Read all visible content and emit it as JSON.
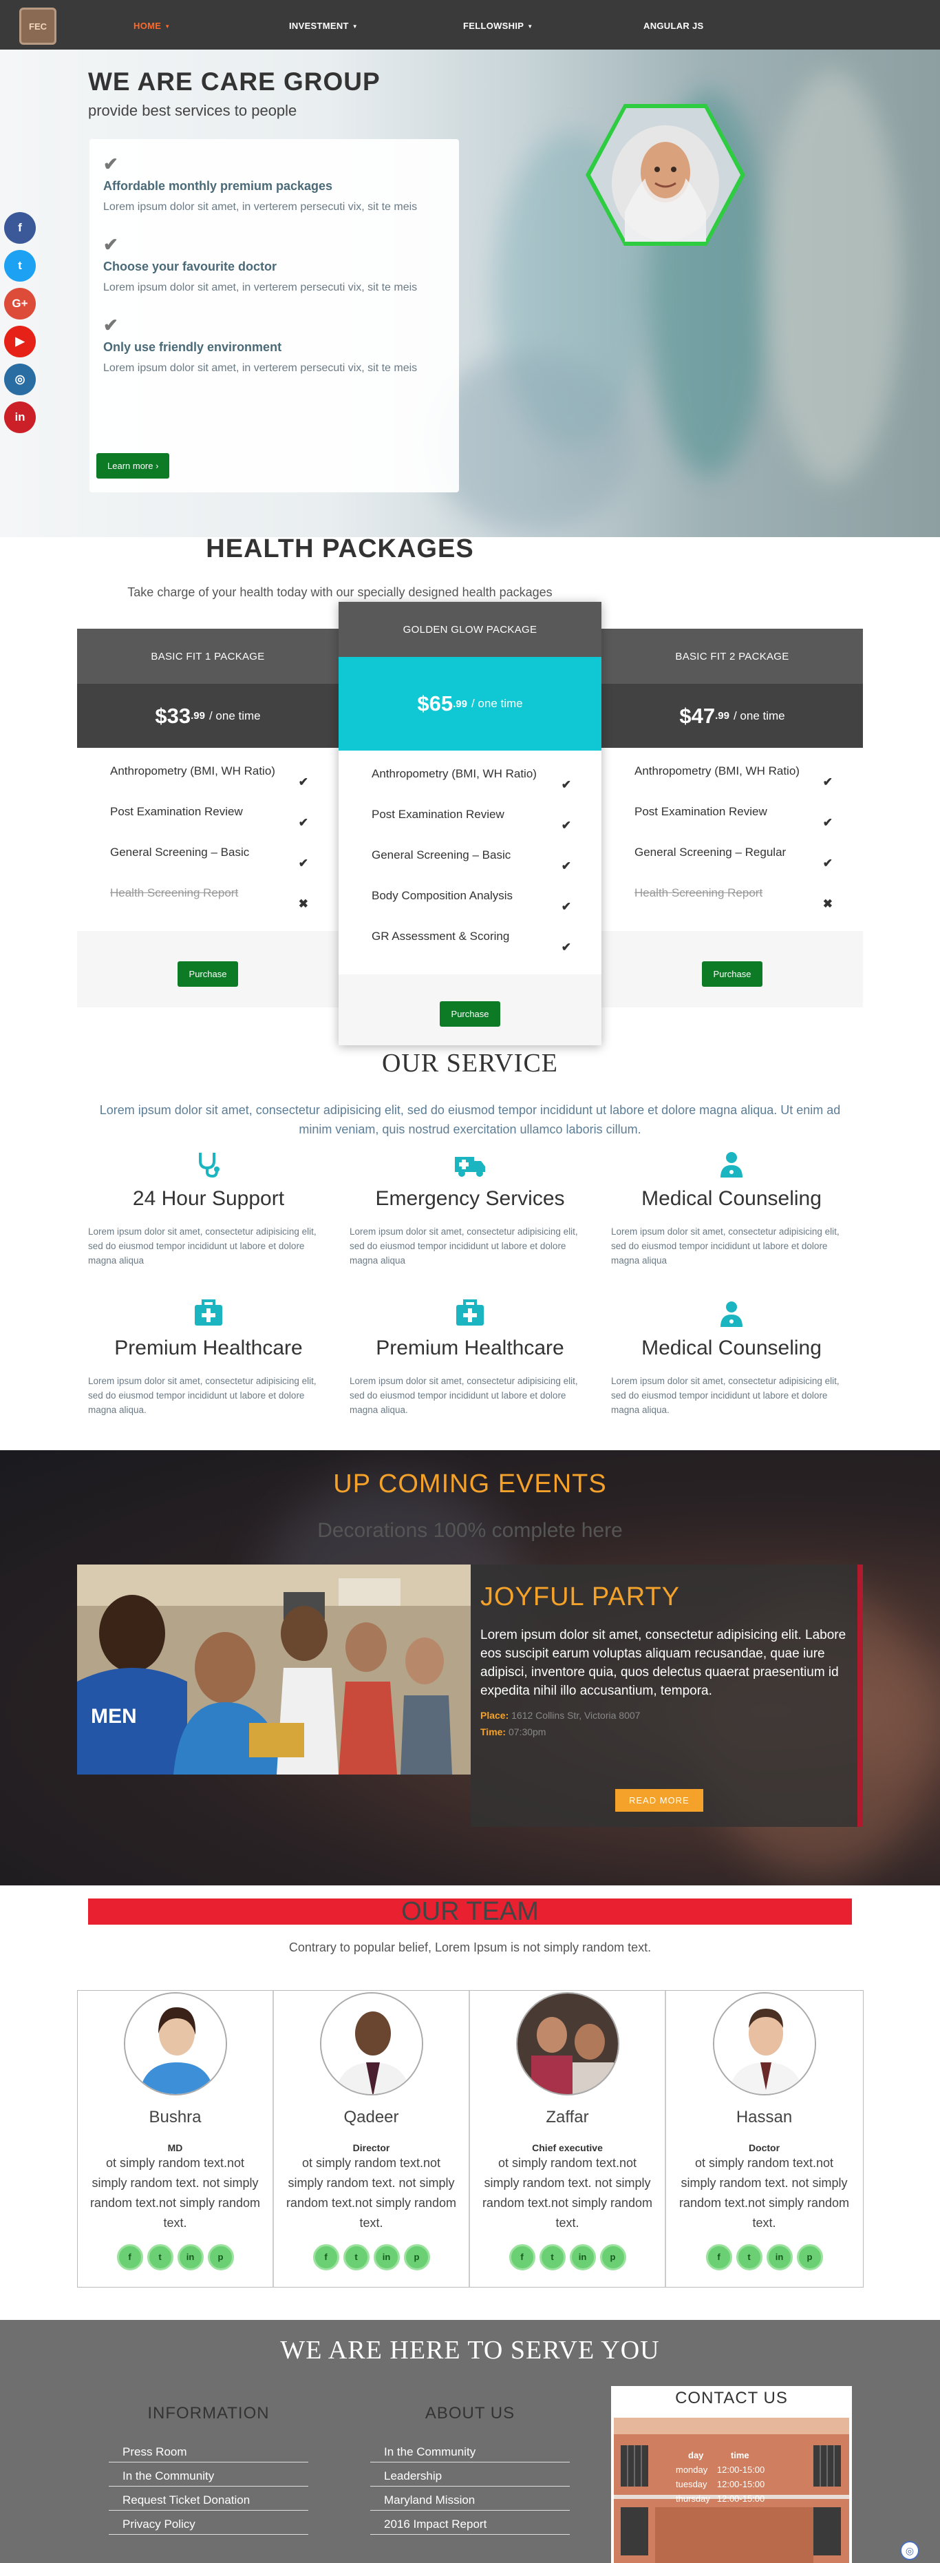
{
  "nav": {
    "logo": "FEC",
    "items": [
      {
        "label": "HOME",
        "active": true,
        "dropdown": true
      },
      {
        "label": "INVESTMENT",
        "active": false,
        "dropdown": true
      },
      {
        "label": "FELLOWSHIP",
        "active": false,
        "dropdown": true
      },
      {
        "label": "ANGULAR JS",
        "active": false,
        "dropdown": false
      }
    ]
  },
  "hero": {
    "title": "WE ARE CARE GROUP",
    "subtitle": "provide best services to people",
    "features": [
      {
        "title": "Affordable monthly premium packages",
        "text": "Lorem ipsum dolor sit amet, in verterem persecuti vix, sit te meis"
      },
      {
        "title": "Choose your favourite doctor",
        "text": "Lorem ipsum dolor sit amet, in verterem persecuti vix, sit te meis"
      },
      {
        "title": "Only use friendly environment",
        "text": "Lorem ipsum dolor sit amet, in verterem persecuti vix, sit te meis"
      }
    ],
    "button": "Learn more ›"
  },
  "social": [
    {
      "icon": "facebook-icon",
      "glyph": "f",
      "color": "#3b5998"
    },
    {
      "icon": "twitter-icon",
      "glyph": "t",
      "color": "#1da1f2"
    },
    {
      "icon": "google-plus-icon",
      "glyph": "G+",
      "color": "#dd4b39"
    },
    {
      "icon": "youtube-icon",
      "glyph": "▶",
      "color": "#e62117"
    },
    {
      "icon": "instagram-icon",
      "glyph": "◎",
      "color": "#2a6da3"
    },
    {
      "icon": "pinterest-icon",
      "glyph": "in",
      "color": "#cb2027"
    }
  ],
  "packages": {
    "title": "HEALTH PACKAGES",
    "subtitle": "Take charge of your health today with our specially designed health packages",
    "items": [
      {
        "name": "BASIC FIT 1 PACKAGE",
        "price": "$33",
        "cents": ".99",
        "period": "/ one time",
        "features": [
          {
            "text": "Anthropometry (BMI, WH Ratio)",
            "mark": "✔",
            "strike": false
          },
          {
            "text": "Post Examination Review",
            "mark": "✔",
            "strike": false
          },
          {
            "text": "General Screening – Basic",
            "mark": "✔",
            "strike": false
          },
          {
            "text": "Health Screening Report",
            "mark": "✖",
            "strike": true
          }
        ],
        "button": "Purchase"
      },
      {
        "name": "GOLDEN GLOW PACKAGE",
        "price": "$65",
        "cents": ".99",
        "period": "/ one time",
        "features": [
          {
            "text": "Anthropometry (BMI, WH Ratio)",
            "mark": "✔",
            "strike": false
          },
          {
            "text": "Post Examination Review",
            "mark": "✔",
            "strike": false
          },
          {
            "text": "General Screening – Basic",
            "mark": "✔",
            "strike": false
          },
          {
            "text": "Body Composition Analysis",
            "mark": "✔",
            "strike": false
          },
          {
            "text": "GR Assessment & Scoring",
            "mark": "✔",
            "strike": false
          }
        ],
        "button": "Purchase"
      },
      {
        "name": "BASIC FIT 2 PACKAGE",
        "price": "$47",
        "cents": ".99",
        "period": "/ one time",
        "features": [
          {
            "text": "Anthropometry (BMI, WH Ratio)",
            "mark": "✔",
            "strike": false
          },
          {
            "text": "Post Examination Review",
            "mark": "✔",
            "strike": false
          },
          {
            "text": "General Screening – Regular",
            "mark": "✔",
            "strike": false
          },
          {
            "text": "Health Screening Report",
            "mark": "✖",
            "strike": true
          }
        ],
        "button": "Purchase"
      }
    ]
  },
  "service": {
    "title": "OUR SERVICE",
    "subtitle": "Lorem ipsum dolor sit amet, consectetur adipisicing elit, sed do eiusmod tempor incididunt ut labore et dolore magna aliqua. Ut enim ad minim veniam, quis nostrud exercitation ullamco laboris cillum.",
    "items": [
      {
        "icon": "stethoscope-icon",
        "title": "24 Hour Support",
        "text": "Lorem ipsum dolor sit amet, consectetur adipisicing elit, sed do eiusmod tempor incididunt ut labore et dolore magna aliqua"
      },
      {
        "icon": "ambulance-icon",
        "title": "Emergency Services",
        "text": "Lorem ipsum dolor sit amet, consectetur adipisicing elit, sed do eiusmod tempor incididunt ut labore et dolore magna aliqua"
      },
      {
        "icon": "doctor-icon",
        "title": "Medical Counseling",
        "text": "Lorem ipsum dolor sit amet, consectetur adipisicing elit, sed do eiusmod tempor incididunt ut labore et dolore magna aliqua"
      },
      {
        "icon": "medkit-icon",
        "title": "Premium Healthcare",
        "text": "Lorem ipsum dolor sit amet, consectetur adipisicing elit, sed do eiusmod tempor incididunt ut labore et dolore magna aliqua."
      },
      {
        "icon": "medkit-icon",
        "title": "Premium Healthcare",
        "text": "Lorem ipsum dolor sit amet, consectetur adipisicing elit, sed do eiusmod tempor incididunt ut labore et dolore magna aliqua."
      },
      {
        "icon": "doctor-icon",
        "title": "Medical Counseling",
        "text": "Lorem ipsum dolor sit amet, consectetur adipisicing elit, sed do eiusmod tempor incididunt ut labore et dolore magna aliqua."
      }
    ]
  },
  "events": {
    "title": "UP COMING EVENTS",
    "subtitle": "Decorations 100% complete here",
    "card": {
      "title": "JOYFUL PARTY",
      "text": "Lorem ipsum dolor sit amet, consectetur adipisicing elit. Labore eos suscipit earum voluptas aliquam recusandae, quae iure adipisci, inventore quia, quos delectus quaerat praesentium id expedita nihil illo accusantium, tempora.",
      "place_label": "Place:",
      "place": "1612 Collins Str, Victoria 8007",
      "time_label": "Time:",
      "time": "07:30pm",
      "button": "READ MORE"
    }
  },
  "team": {
    "title": "OUR TEAM",
    "subtitle": "Contrary to popular belief, Lorem Ipsum is not simply random text.",
    "members": [
      {
        "name": "Bushra",
        "role": "MD",
        "text": "ot simply random text.not simply random text. not simply random text.not simply random text."
      },
      {
        "name": "Qadeer",
        "role": "Director",
        "text": "ot simply random text.not simply random text. not simply random text.not simply random text."
      },
      {
        "name": "Zaffar",
        "role": "Chief executive",
        "text": "ot simply random text.not simply random text. not simply random text.not simply random text."
      },
      {
        "name": "Hassan",
        "role": "Doctor",
        "text": "ot simply random text.not simply random text. not simply random text.not simply random text."
      }
    ],
    "social_glyphs": [
      "f",
      "t",
      "in",
      "p"
    ]
  },
  "footer": {
    "title": "WE ARE HERE TO SERVE YOU",
    "info": {
      "title": "INFORMATION",
      "links": [
        "Press Room",
        "In the Community",
        "Request Ticket Donation",
        "Privacy Policy"
      ]
    },
    "about": {
      "title": "ABOUT US",
      "links": [
        "In the Community",
        "Leadership",
        "Maryland Mission",
        "2016 Impact Report"
      ]
    },
    "contact": {
      "title": "CONTACT US",
      "headers": [
        "day",
        "time"
      ],
      "rows": [
        [
          "monday",
          "12:00-15:00"
        ],
        [
          "tuesday",
          "12:00-15:00"
        ],
        [
          "thursday",
          "12:00-15:00"
        ]
      ]
    }
  }
}
